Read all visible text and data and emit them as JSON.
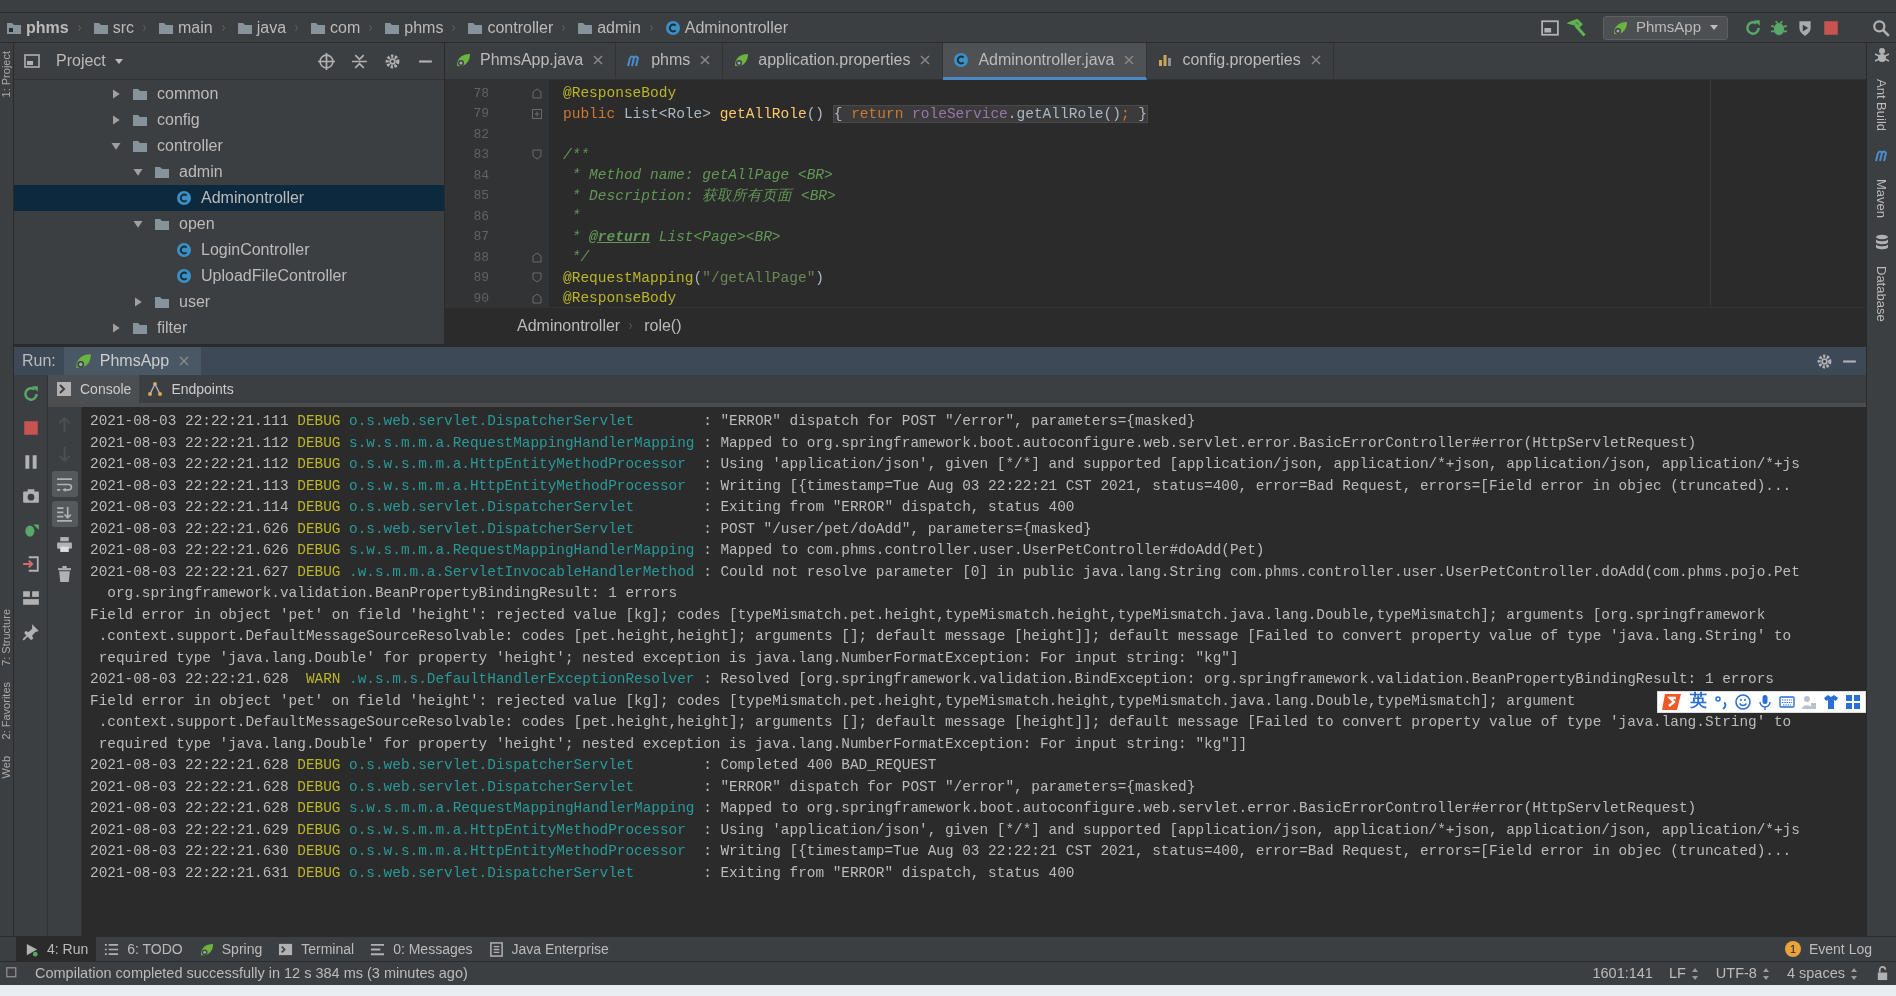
{
  "nav_path": [
    {
      "kind": "project",
      "label": "phms"
    },
    {
      "kind": "folder",
      "label": "src"
    },
    {
      "kind": "folder",
      "label": "main"
    },
    {
      "kind": "folder",
      "label": "java"
    },
    {
      "kind": "folder",
      "label": "com"
    },
    {
      "kind": "folder",
      "label": "phms"
    },
    {
      "kind": "folder",
      "label": "controller"
    },
    {
      "kind": "folder",
      "label": "admin"
    },
    {
      "kind": "class",
      "label": "Adminontroller"
    }
  ],
  "run_config": {
    "label": "PhmsApp"
  },
  "project_panel": {
    "title": "Project"
  },
  "tree": [
    {
      "kind": "folder",
      "label": "common",
      "expanded": false,
      "selected": false
    },
    {
      "kind": "folder",
      "label": "config",
      "expanded": false,
      "selected": false
    },
    {
      "kind": "folder",
      "label": "controller",
      "expanded": true,
      "selected": false,
      "children": [
        {
          "kind": "folder",
          "label": "admin",
          "expanded": true,
          "selected": false,
          "children": [
            {
              "kind": "class",
              "label": "Adminontroller",
              "selected": true
            }
          ]
        },
        {
          "kind": "folder",
          "label": "open",
          "expanded": true,
          "selected": false,
          "children": [
            {
              "kind": "class",
              "label": "LoginController",
              "selected": false
            },
            {
              "kind": "class",
              "label": "UploadFileController",
              "selected": false
            }
          ]
        },
        {
          "kind": "folder",
          "label": "user",
          "expanded": false,
          "selected": false
        }
      ]
    },
    {
      "kind": "folder",
      "label": "filter",
      "expanded": false,
      "selected": false
    }
  ],
  "editor_tabs": [
    {
      "kind": "spring",
      "label": "PhmsApp.java",
      "selected": false
    },
    {
      "kind": "maven",
      "label": "phms",
      "selected": false
    },
    {
      "kind": "spring",
      "label": "application.properties",
      "selected": false
    },
    {
      "kind": "class",
      "label": "Adminontroller.java",
      "selected": true
    },
    {
      "kind": "properties",
      "label": "config.properties",
      "selected": false
    }
  ],
  "code_lines": [
    {
      "num": "78",
      "kind": "fold-end",
      "tokens": [
        {
          "kind": "annotation",
          "text": "@ResponseBody"
        }
      ]
    },
    {
      "num": "79",
      "kind": "fold-collapsed",
      "tokens": [
        {
          "kind": "keyword",
          "text": "public "
        },
        {
          "kind": "plain",
          "text": "List<Role> "
        },
        {
          "kind": "method",
          "text": "getAllRole"
        },
        {
          "kind": "plain",
          "text": "() "
        },
        {
          "kind": "folded",
          "tokens": [
            {
              "kind": "plain",
              "text": "{ "
            },
            {
              "kind": "keyword",
              "text": "return "
            },
            {
              "kind": "field",
              "text": "roleService"
            },
            {
              "kind": "plain",
              "text": ".getAllRole()"
            },
            {
              "kind": "keyword",
              "text": ";"
            },
            {
              "kind": "plain",
              "text": " }"
            }
          ]
        }
      ]
    },
    {
      "num": "82",
      "kind": "plain"
    },
    {
      "num": "83",
      "kind": "fold-start",
      "tokens": [
        {
          "kind": "doc",
          "text": "/**"
        }
      ]
    },
    {
      "num": "84",
      "kind": "plain",
      "tokens": [
        {
          "kind": "doc",
          "text": " * Method name: getAllPage <BR>"
        }
      ]
    },
    {
      "num": "85",
      "kind": "plain",
      "tokens": [
        {
          "kind": "doc",
          "text": " * Description: 获取所有页面 <BR>"
        }
      ]
    },
    {
      "num": "86",
      "kind": "plain",
      "tokens": [
        {
          "kind": "doc",
          "text": " *"
        }
      ]
    },
    {
      "num": "87",
      "kind": "plain",
      "tokens": [
        {
          "kind": "doc",
          "text": " * "
        },
        {
          "kind": "doctag",
          "text": "@return"
        },
        {
          "kind": "doc",
          "text": " List<Page><BR>"
        }
      ]
    },
    {
      "num": "88",
      "kind": "fold-end",
      "tokens": [
        {
          "kind": "doc",
          "text": " */"
        }
      ]
    },
    {
      "num": "89",
      "kind": "fold-start",
      "tokens": [
        {
          "kind": "annotation",
          "text": "@RequestMapping"
        },
        {
          "kind": "plain",
          "text": "("
        },
        {
          "kind": "string",
          "text": "\"/getAllPage\""
        },
        {
          "kind": "plain",
          "text": ")"
        }
      ]
    },
    {
      "num": "90",
      "kind": "fold-end",
      "tokens": [
        {
          "kind": "annotation",
          "text": "@ResponseBody"
        }
      ]
    }
  ],
  "editor_breadcrumb": [
    "Adminontroller",
    "role()"
  ],
  "left_stripe": [
    "1: Project",
    "7: Structure",
    "2: Favorites",
    "Web"
  ],
  "right_stripe": [
    {
      "kind": "ant",
      "label": "Ant Build"
    },
    {
      "kind": "maven",
      "label": "Maven"
    },
    {
      "kind": "database",
      "label": "Database"
    }
  ],
  "run_panel": {
    "label": "Run:",
    "tabs": [
      {
        "label": "PhmsApp",
        "selected": true
      }
    ],
    "subtabs": [
      {
        "kind": "console",
        "label": "Console",
        "selected": true
      },
      {
        "kind": "endpoints",
        "label": "Endpoints",
        "selected": false
      }
    ]
  },
  "console_toggles": [
    {
      "on": false,
      "disabled": true
    },
    {
      "on": false,
      "disabled": true
    },
    {
      "on": true,
      "disabled": false
    },
    {
      "on": true,
      "disabled": false
    },
    {
      "on": false,
      "disabled": false
    },
    {
      "on": false,
      "disabled": false
    }
  ],
  "console_lines": [
    {
      "kind": "log",
      "time": "2021-08-03 22:22:21.111",
      "level": "DEBUG",
      "logger": "o.s.web.servlet.DispatcherServlet",
      "message": ": \"ERROR\" dispatch for POST \"/error\", parameters={masked}"
    },
    {
      "kind": "log",
      "time": "2021-08-03 22:22:21.112",
      "level": "DEBUG",
      "logger": "s.w.s.m.m.a.RequestMappingHandlerMapping",
      "message": ": Mapped to org.springframework.boot.autoconfigure.web.servlet.error.BasicErrorController#error(HttpServletRequest)"
    },
    {
      "kind": "log",
      "time": "2021-08-03 22:22:21.112",
      "level": "DEBUG",
      "logger": "o.s.w.s.m.m.a.HttpEntityMethodProcessor",
      "message": ": Using 'application/json', given [*/*] and supported [application/json, application/*+json, application/json, application/*+js"
    },
    {
      "kind": "log",
      "time": "2021-08-03 22:22:21.113",
      "level": "DEBUG",
      "logger": "o.s.w.s.m.m.a.HttpEntityMethodProcessor",
      "message": ": Writing [{timestamp=Tue Aug 03 22:22:21 CST 2021, status=400, error=Bad Request, errors=[Field error in objec (truncated)..."
    },
    {
      "kind": "log",
      "time": "2021-08-03 22:22:21.114",
      "level": "DEBUG",
      "logger": "o.s.web.servlet.DispatcherServlet",
      "message": ": Exiting from \"ERROR\" dispatch, status 400"
    },
    {
      "kind": "log",
      "time": "2021-08-03 22:22:21.626",
      "level": "DEBUG",
      "logger": "o.s.web.servlet.DispatcherServlet",
      "message": ": POST \"/user/pet/doAdd\", parameters={masked}"
    },
    {
      "kind": "log",
      "time": "2021-08-03 22:22:21.626",
      "level": "DEBUG",
      "logger": "s.w.s.m.m.a.RequestMappingHandlerMapping",
      "message": ": Mapped to com.phms.controller.user.UserPetController#doAdd(Pet)"
    },
    {
      "kind": "log",
      "time": "2021-08-03 22:22:21.627",
      "level": "DEBUG",
      "logger": ".w.s.m.m.a.ServletInvocableHandlerMethod",
      "message": ": Could not resolve parameter [0] in public java.lang.String com.phms.controller.user.UserPetController.doAdd(com.phms.pojo.Pet"
    },
    {
      "kind": "text",
      "text": "  org.springframework.validation.BeanPropertyBindingResult: 1 errors"
    },
    {
      "kind": "text",
      "text": "Field error in object 'pet' on field 'height': rejected value [kg]; codes [typeMismatch.pet.height,typeMismatch.height,typeMismatch.java.lang.Double,typeMismatch]; arguments [org.springframework"
    },
    {
      "kind": "text",
      "text": " .context.support.DefaultMessageSourceResolvable: codes [pet.height,height]; arguments []; default message [height]]; default message [Failed to convert property value of type 'java.lang.String' to"
    },
    {
      "kind": "text",
      "text": " required type 'java.lang.Double' for property 'height'; nested exception is java.lang.NumberFormatException: For input string: \"kg\"]"
    },
    {
      "kind": "log",
      "time": "2021-08-03 22:22:21.628",
      "level": "WARN",
      "logger": ".w.s.m.s.DefaultHandlerExceptionResolver",
      "message": ": Resolved [org.springframework.validation.BindException: org.springframework.validation.BeanPropertyBindingResult: 1 errors"
    },
    {
      "kind": "text",
      "text": "Field error in object 'pet' on field 'height': rejected value [kg]; codes [typeMismatch.pet.height,typeMismatch.height,typeMismatch.java.lang.Double,typeMismatch]; argument"
    },
    {
      "kind": "text",
      "text": " .context.support.DefaultMessageSourceResolvable: codes [pet.height,height]; arguments []; default message [height]]; default message [Failed to convert property value of type 'java.lang.String' to"
    },
    {
      "kind": "text",
      "text": " required type 'java.lang.Double' for property 'height'; nested exception is java.lang.NumberFormatException: For input string: \"kg\"]]"
    },
    {
      "kind": "log",
      "time": "2021-08-03 22:22:21.628",
      "level": "DEBUG",
      "logger": "o.s.web.servlet.DispatcherServlet",
      "message": ": Completed 400 BAD_REQUEST"
    },
    {
      "kind": "log",
      "time": "2021-08-03 22:22:21.628",
      "level": "DEBUG",
      "logger": "o.s.web.servlet.DispatcherServlet",
      "message": ": \"ERROR\" dispatch for POST \"/error\", parameters={masked}"
    },
    {
      "kind": "log",
      "time": "2021-08-03 22:22:21.628",
      "level": "DEBUG",
      "logger": "s.w.s.m.m.a.RequestMappingHandlerMapping",
      "message": ": Mapped to org.springframework.boot.autoconfigure.web.servlet.error.BasicErrorController#error(HttpServletRequest)"
    },
    {
      "kind": "log",
      "time": "2021-08-03 22:22:21.629",
      "level": "DEBUG",
      "logger": "o.s.w.s.m.m.a.HttpEntityMethodProcessor",
      "message": ": Using 'application/json', given [*/*] and supported [application/json, application/*+json, application/json, application/*+js"
    },
    {
      "kind": "log",
      "time": "2021-08-03 22:22:21.630",
      "level": "DEBUG",
      "logger": "o.s.w.s.m.m.a.HttpEntityMethodProcessor",
      "message": ": Writing [{timestamp=Tue Aug 03 22:22:21 CST 2021, status=400, error=Bad Request, errors=[Field error in objec (truncated)..."
    },
    {
      "kind": "log",
      "time": "2021-08-03 22:22:21.631",
      "level": "DEBUG",
      "logger": "o.s.web.servlet.DispatcherServlet",
      "message": ": Exiting from \"ERROR\" dispatch, status 400"
    }
  ],
  "ime_toolbar": {
    "mode": "英"
  },
  "bottom_tools": [
    {
      "kind": "run",
      "label": "4: Run",
      "selected": true
    },
    {
      "kind": "todo",
      "label": "6: TODO",
      "selected": false
    },
    {
      "kind": "spring",
      "label": "Spring",
      "selected": false
    },
    {
      "kind": "terminal",
      "label": "Terminal",
      "selected": false
    },
    {
      "kind": "messages",
      "label": "0: Messages",
      "selected": false
    },
    {
      "kind": "javaee",
      "label": "Java Enterprise",
      "selected": false
    }
  ],
  "event_log": {
    "label": "Event Log",
    "badge": "1"
  },
  "status_bar": {
    "message": "Compilation completed successfully in 12 s 384 ms (3 minutes ago)",
    "position": "1601:141",
    "line_separator": "LF",
    "encoding": "UTF-8",
    "indent": "4 spaces"
  }
}
